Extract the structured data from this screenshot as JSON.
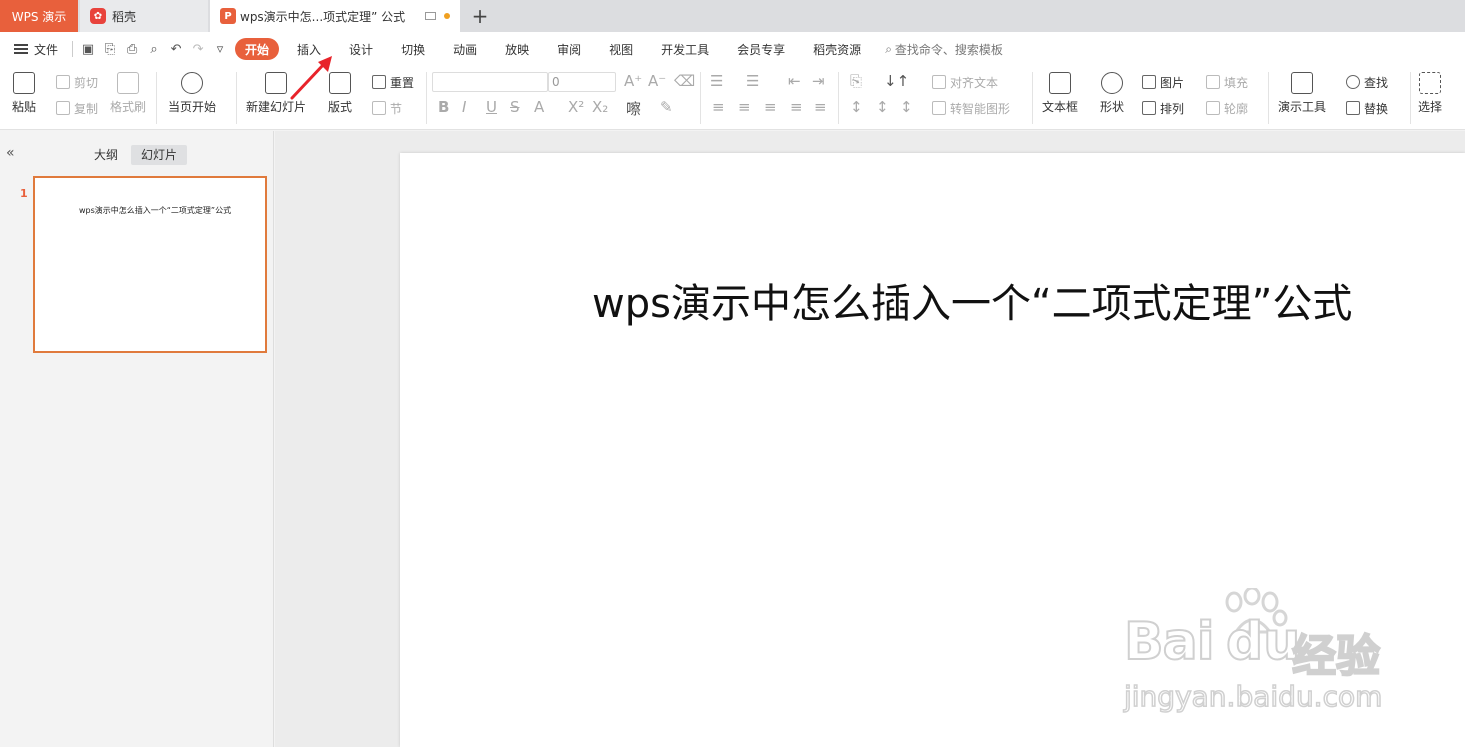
{
  "tabs": {
    "app": "WPS 演示",
    "daoke": "稻壳",
    "doc_title": "wps演示中怎...项式定理” 公式",
    "add": "+"
  },
  "menubar": {
    "file": "文件",
    "tabs": [
      "开始",
      "插入",
      "设计",
      "切换",
      "动画",
      "放映",
      "审阅",
      "视图",
      "开发工具",
      "会员专享",
      "稻壳资源"
    ],
    "active_tab": "开始",
    "search_placeholder": "查找命令、搜索模板"
  },
  "ribbon": {
    "paste": "粘贴",
    "cut": "剪切",
    "copy": "复制",
    "format_painter": "格式刷",
    "from_current": "当页开始",
    "new_slide": "新建幻灯片",
    "layout": "版式",
    "reset": "重置",
    "section": "节",
    "font_size": "0",
    "align_text": "对齐文本",
    "smart_art": "转智能图形",
    "textbox": "文本框",
    "shape": "形状",
    "picture": "图片",
    "arrange": "排列",
    "fill": "填充",
    "outline": "轮廓",
    "present_tools": "演示工具",
    "find": "查找",
    "replace": "替换",
    "select": "选择"
  },
  "left_panel": {
    "tab_outline": "大纲",
    "tab_slides": "幻灯片",
    "slide_number": "1",
    "thumb_title": "wps演示中怎么插入一个“二项式定理”公式"
  },
  "slide": {
    "title": "wps演示中怎么插入一个“二项式定理”公式"
  },
  "watermark": {
    "brand": "Bai",
    "brand2": "du",
    "cn": "经验",
    "url": "jingyan.baidu.com"
  },
  "colors": {
    "accent": "#e8603c",
    "arrow": "#e8232a"
  }
}
